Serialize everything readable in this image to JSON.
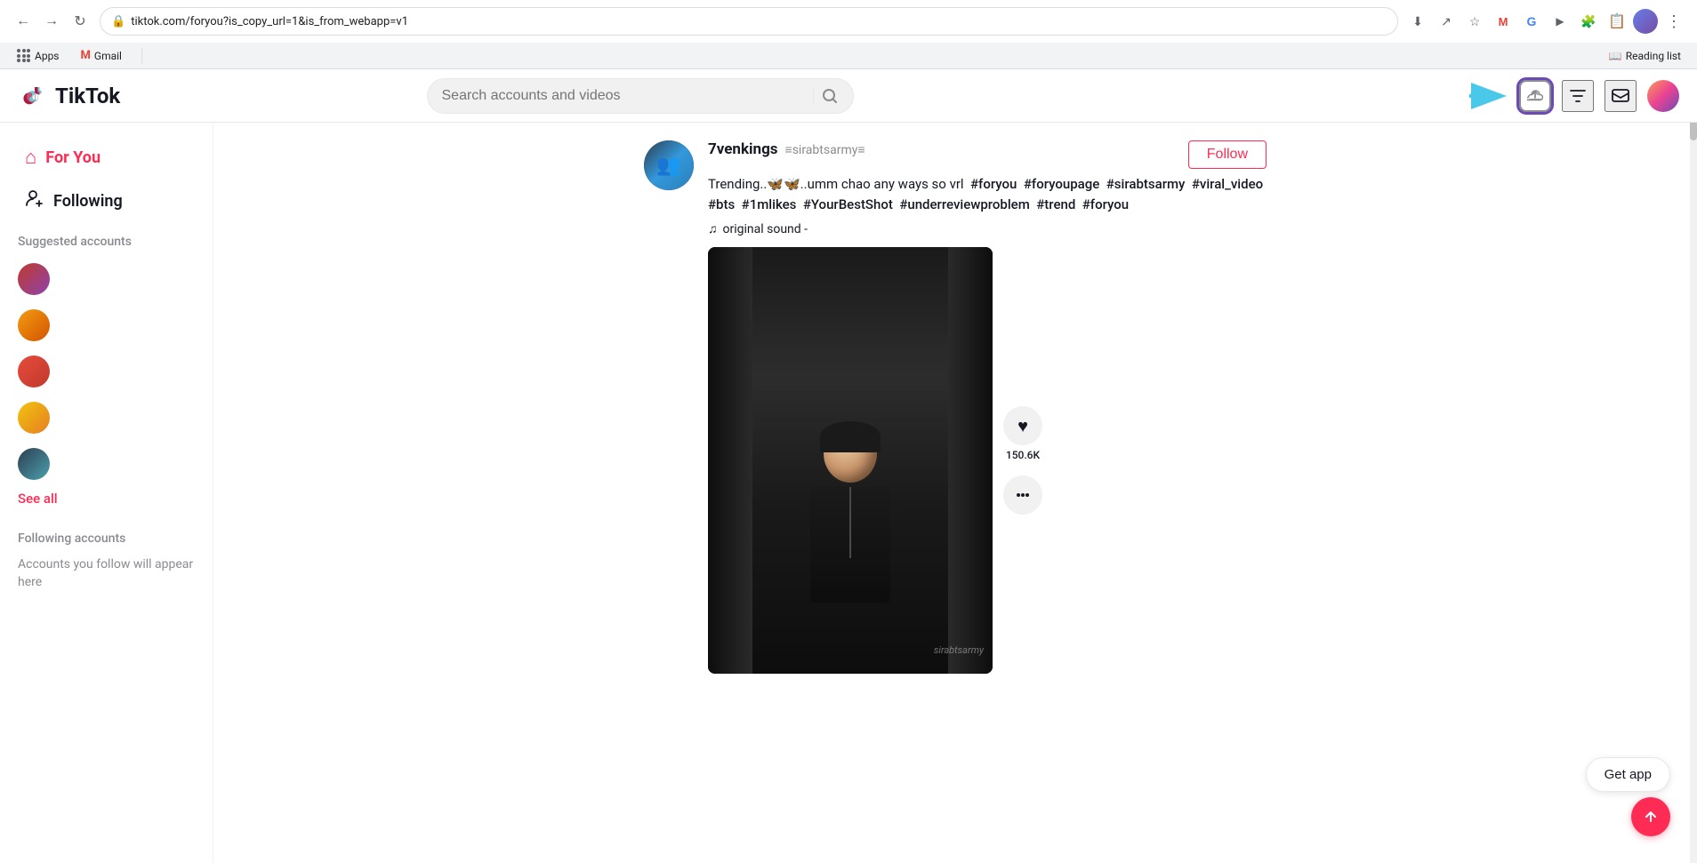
{
  "browser": {
    "url": "tiktok.com/foryou?is_copy_url=1&is_from_webapp=v1",
    "back_disabled": false,
    "forward_disabled": false,
    "bookmarks": [
      {
        "id": "apps",
        "label": "Apps"
      },
      {
        "id": "gmail",
        "label": "Gmail"
      }
    ],
    "reading_list": "Reading list"
  },
  "header": {
    "logo_text": "TikTok",
    "search_placeholder": "Search accounts and videos",
    "upload_title": "Upload",
    "filter_title": "Filter",
    "messages_title": "Messages"
  },
  "sidebar": {
    "nav_items": [
      {
        "id": "for-you",
        "label": "For You",
        "active": true
      },
      {
        "id": "following",
        "label": "Following",
        "active": false
      }
    ],
    "suggested_accounts_title": "Suggested accounts",
    "see_all_label": "See all",
    "following_accounts_title": "Following accounts",
    "following_empty_text": "Accounts you follow will appear here"
  },
  "post": {
    "username": "7venkings",
    "handle": "≡sirabtsarmy≡",
    "description": "Trending..🦋🦋..umm chao any ways so vrl #foryou #foryoupage #sirabtsarmy #viral_video #bts #1mlikes #YourBestShot #underreviewproblem #trend #foryou",
    "sound": "original sound -",
    "follow_label": "Follow",
    "likes_count": "150.6K",
    "watermark": "sirabtsarmy"
  },
  "get_app": {
    "label": "Get app"
  },
  "icons": {
    "back": "←",
    "forward": "→",
    "refresh": "↻",
    "lock": "🔒",
    "download": "⬇",
    "share": "↗",
    "star": "☆",
    "extensions": "🧩",
    "more": "⋮",
    "search": "🔍",
    "home": "⌂",
    "person": "👤",
    "music": "♪",
    "heart": "♥",
    "comment": "•••",
    "upload_arrow": "↑",
    "scroll_up": "↑"
  }
}
